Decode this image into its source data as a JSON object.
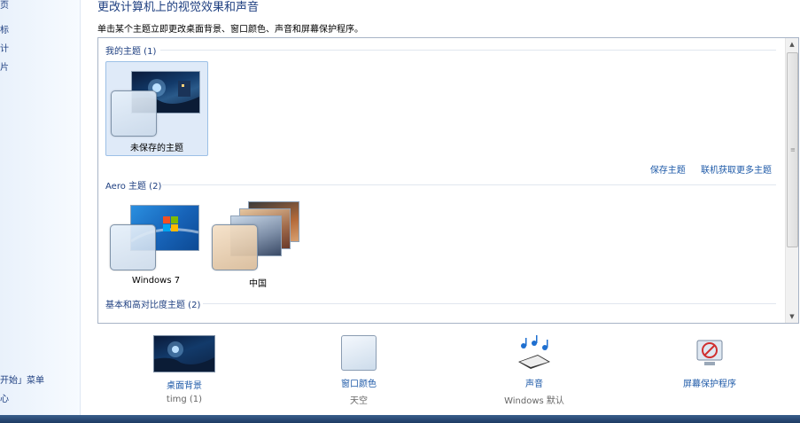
{
  "left_pane": {
    "items": [
      {
        "label": "页"
      },
      {
        "label": "标"
      },
      {
        "label": "计"
      },
      {
        "label": "片"
      },
      {
        "label": "开始」菜单"
      },
      {
        "label": "心"
      }
    ]
  },
  "header": {
    "title": "更改计算机上的视觉效果和声音",
    "subtitle": "单击某个主题立即更改桌面背景、窗口颜色、声音和屏幕保护程序。"
  },
  "themes": {
    "my_group": "我的主题 (1)",
    "my_themes": [
      {
        "label": "未保存的主题"
      }
    ],
    "links": {
      "save": "保存主题",
      "more": "联机获取更多主题"
    },
    "aero_group": "Aero 主题 (2)",
    "aero_themes": [
      {
        "label": "Windows 7"
      },
      {
        "label": "中国"
      }
    ],
    "basic_group": "基本和高对比度主题 (2)"
  },
  "bottom": {
    "desktop_background": {
      "label": "桌面背景",
      "value": "timg (1)"
    },
    "window_color": {
      "label": "窗口颜色",
      "value": "天空"
    },
    "sounds": {
      "label": "声音",
      "value": "Windows 默认"
    },
    "screensaver": {
      "label": "屏幕保护程序"
    }
  },
  "colors": {
    "link": "#1e5aa8",
    "heading": "#1e3f80",
    "selection": "#dfeaf8"
  }
}
